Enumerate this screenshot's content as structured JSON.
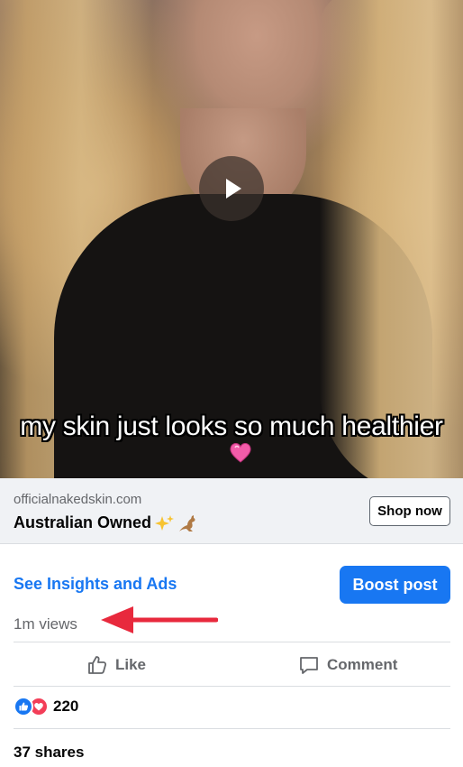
{
  "video": {
    "caption": "my skin just looks so much healthier",
    "caption_emoji": "pink-heart-icon",
    "play_icon": "play-icon"
  },
  "link_card": {
    "domain": "officialnakedskin.com",
    "headline": "Australian Owned",
    "headline_emojis": [
      "sparkles-icon",
      "kangaroo-icon"
    ],
    "cta_label": "Shop now"
  },
  "insights": {
    "link_label": "See Insights and Ads",
    "boost_label": "Boost post",
    "views": "1m views",
    "annotation": "red-arrow-icon"
  },
  "actions": {
    "like_label": "Like",
    "comment_label": "Comment"
  },
  "reactions": {
    "icons": [
      "like-reaction-icon",
      "love-reaction-icon"
    ],
    "count": "220"
  },
  "shares": "37 shares",
  "colors": {
    "accent": "#1877f2",
    "secondary_text": "#65676b",
    "card_bg": "#f0f2f5",
    "annotation_arrow": "#e8293d",
    "love": "#f33e58"
  }
}
